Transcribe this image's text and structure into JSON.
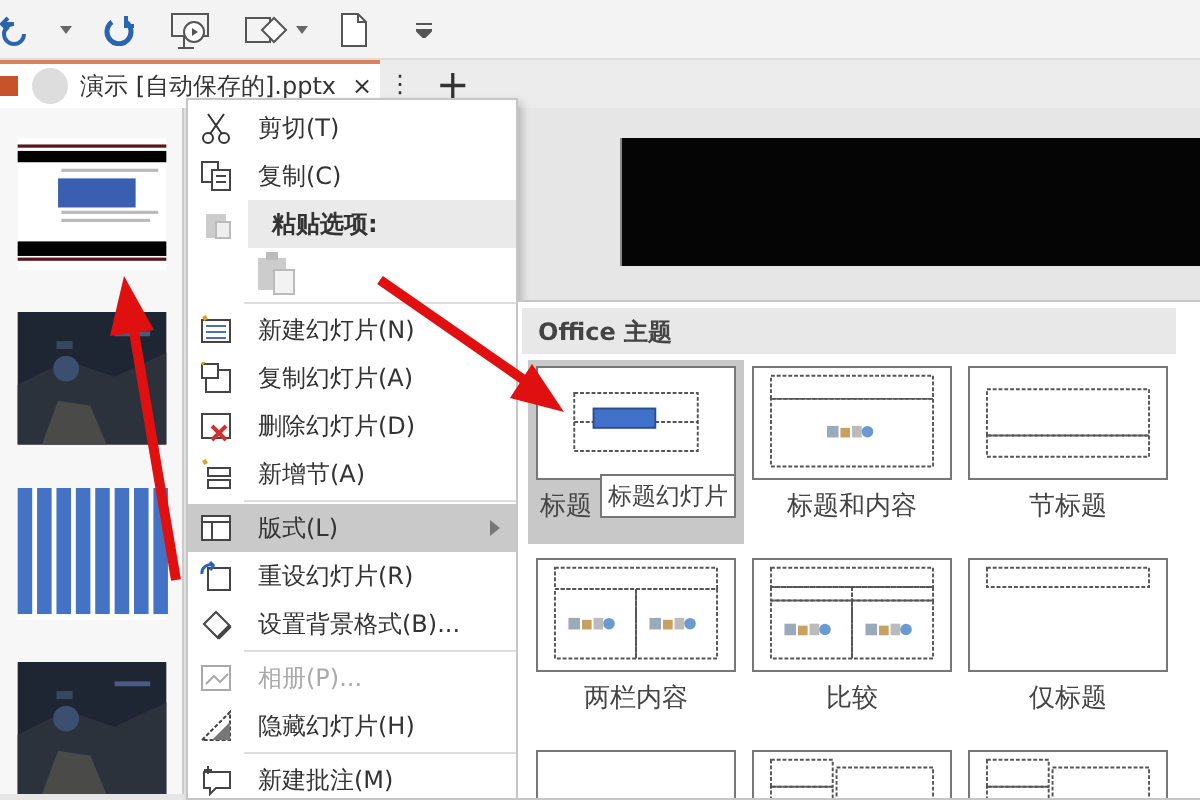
{
  "document_tab": {
    "title": "演示 [自动保存的].pptx",
    "close": "×",
    "more": "⋮",
    "add": "+"
  },
  "slides": [
    {
      "kind": "document"
    },
    {
      "kind": "picture"
    },
    {
      "kind": "bars"
    },
    {
      "kind": "picture"
    }
  ],
  "context_menu": {
    "items": [
      {
        "kind": "item",
        "label": "剪切(T)",
        "highlighted": false,
        "disabled": false,
        "submenu": false
      },
      {
        "kind": "item",
        "label": "复制(C)",
        "highlighted": false,
        "disabled": false,
        "submenu": false
      },
      {
        "kind": "header",
        "label": "粘贴选项:"
      },
      {
        "kind": "paste"
      },
      {
        "kind": "separator"
      },
      {
        "kind": "item",
        "label": "新建幻灯片(N)",
        "highlighted": false,
        "disabled": false,
        "submenu": false
      },
      {
        "kind": "item",
        "label": "复制幻灯片(A)",
        "highlighted": false,
        "disabled": false,
        "submenu": false
      },
      {
        "kind": "item",
        "label": "删除幻灯片(D)",
        "highlighted": false,
        "disabled": false,
        "submenu": false
      },
      {
        "kind": "item",
        "label": "新增节(A)",
        "highlighted": false,
        "disabled": false,
        "submenu": false
      },
      {
        "kind": "separator"
      },
      {
        "kind": "item",
        "label": "版式(L)",
        "highlighted": true,
        "disabled": false,
        "submenu": true
      },
      {
        "kind": "item",
        "label": "重设幻灯片(R)",
        "highlighted": false,
        "disabled": false,
        "submenu": false
      },
      {
        "kind": "item",
        "label": "设置背景格式(B)...",
        "highlighted": false,
        "disabled": false,
        "submenu": false
      },
      {
        "kind": "separator"
      },
      {
        "kind": "item",
        "label": "相册(P)...",
        "highlighted": false,
        "disabled": true,
        "submenu": false
      },
      {
        "kind": "item",
        "label": "隐藏幻灯片(H)",
        "highlighted": false,
        "disabled": false,
        "submenu": false
      },
      {
        "kind": "separator"
      },
      {
        "kind": "item",
        "label": "新建批注(M)",
        "highlighted": false,
        "disabled": false,
        "submenu": false
      }
    ]
  },
  "layout_gallery": {
    "header": "Office 主题",
    "layouts": [
      {
        "kind": "title",
        "label": "标题",
        "selected": true
      },
      {
        "kind": "title-content",
        "label": "标题和内容",
        "selected": false
      },
      {
        "kind": "section",
        "label": "节标题",
        "selected": false
      },
      {
        "kind": "two-content",
        "label": "两栏内容",
        "selected": false
      },
      {
        "kind": "comparison",
        "label": "比较",
        "selected": false
      },
      {
        "kind": "title-only",
        "label": "仅标题",
        "selected": false
      },
      {
        "kind": "blank",
        "selected": false
      },
      {
        "kind": "content-caption",
        "selected": false
      },
      {
        "kind": "picture-caption",
        "selected": false
      }
    ]
  },
  "tooltip": "标题幻灯片"
}
